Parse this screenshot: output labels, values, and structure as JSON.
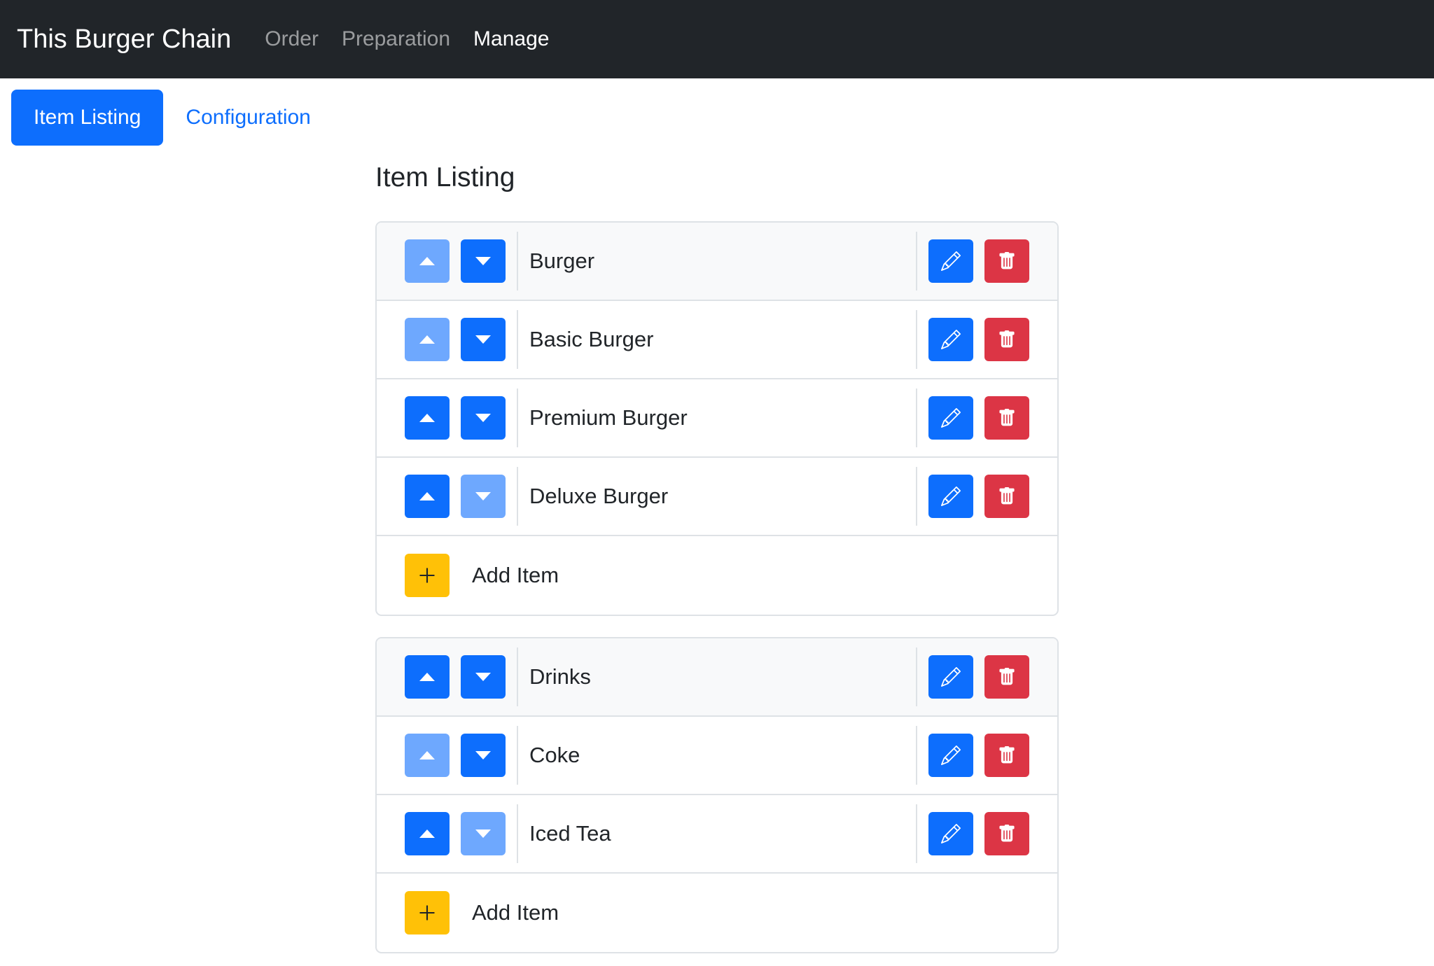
{
  "navbar": {
    "brand": "This Burger Chain",
    "links": [
      {
        "label": "Order"
      },
      {
        "label": "Preparation"
      },
      {
        "label": "Manage"
      }
    ]
  },
  "pills": [
    {
      "label": "Item Listing",
      "active": true
    },
    {
      "label": "Configuration",
      "active": false
    }
  ],
  "heading": "Item Listing",
  "groups": [
    {
      "category": {
        "name": "Burger",
        "up_enabled": false,
        "down_enabled": true
      },
      "items": [
        {
          "name": "Basic Burger",
          "up_enabled": false,
          "down_enabled": true
        },
        {
          "name": "Premium Burger",
          "up_enabled": true,
          "down_enabled": true
        },
        {
          "name": "Deluxe Burger",
          "up_enabled": true,
          "down_enabled": false
        }
      ],
      "add_label": "Add Item"
    },
    {
      "category": {
        "name": "Drinks",
        "up_enabled": true,
        "down_enabled": true
      },
      "items": [
        {
          "name": "Coke",
          "up_enabled": false,
          "down_enabled": true
        },
        {
          "name": "Iced Tea",
          "up_enabled": true,
          "down_enabled": false
        }
      ],
      "add_label": "Add Item"
    }
  ],
  "icons": {
    "up": "caret-up-icon",
    "down": "caret-down-icon",
    "edit": "pencil-icon",
    "delete": "trash-icon",
    "add": "plus-icon"
  },
  "colors": {
    "navbar_bg": "#212529",
    "primary": "#0d6efd",
    "primary_disabled": "#6ea8fe",
    "danger": "#dc3545",
    "warning": "#ffc107",
    "header_row_bg": "#f8f9fa",
    "border": "#dee2e6"
  }
}
